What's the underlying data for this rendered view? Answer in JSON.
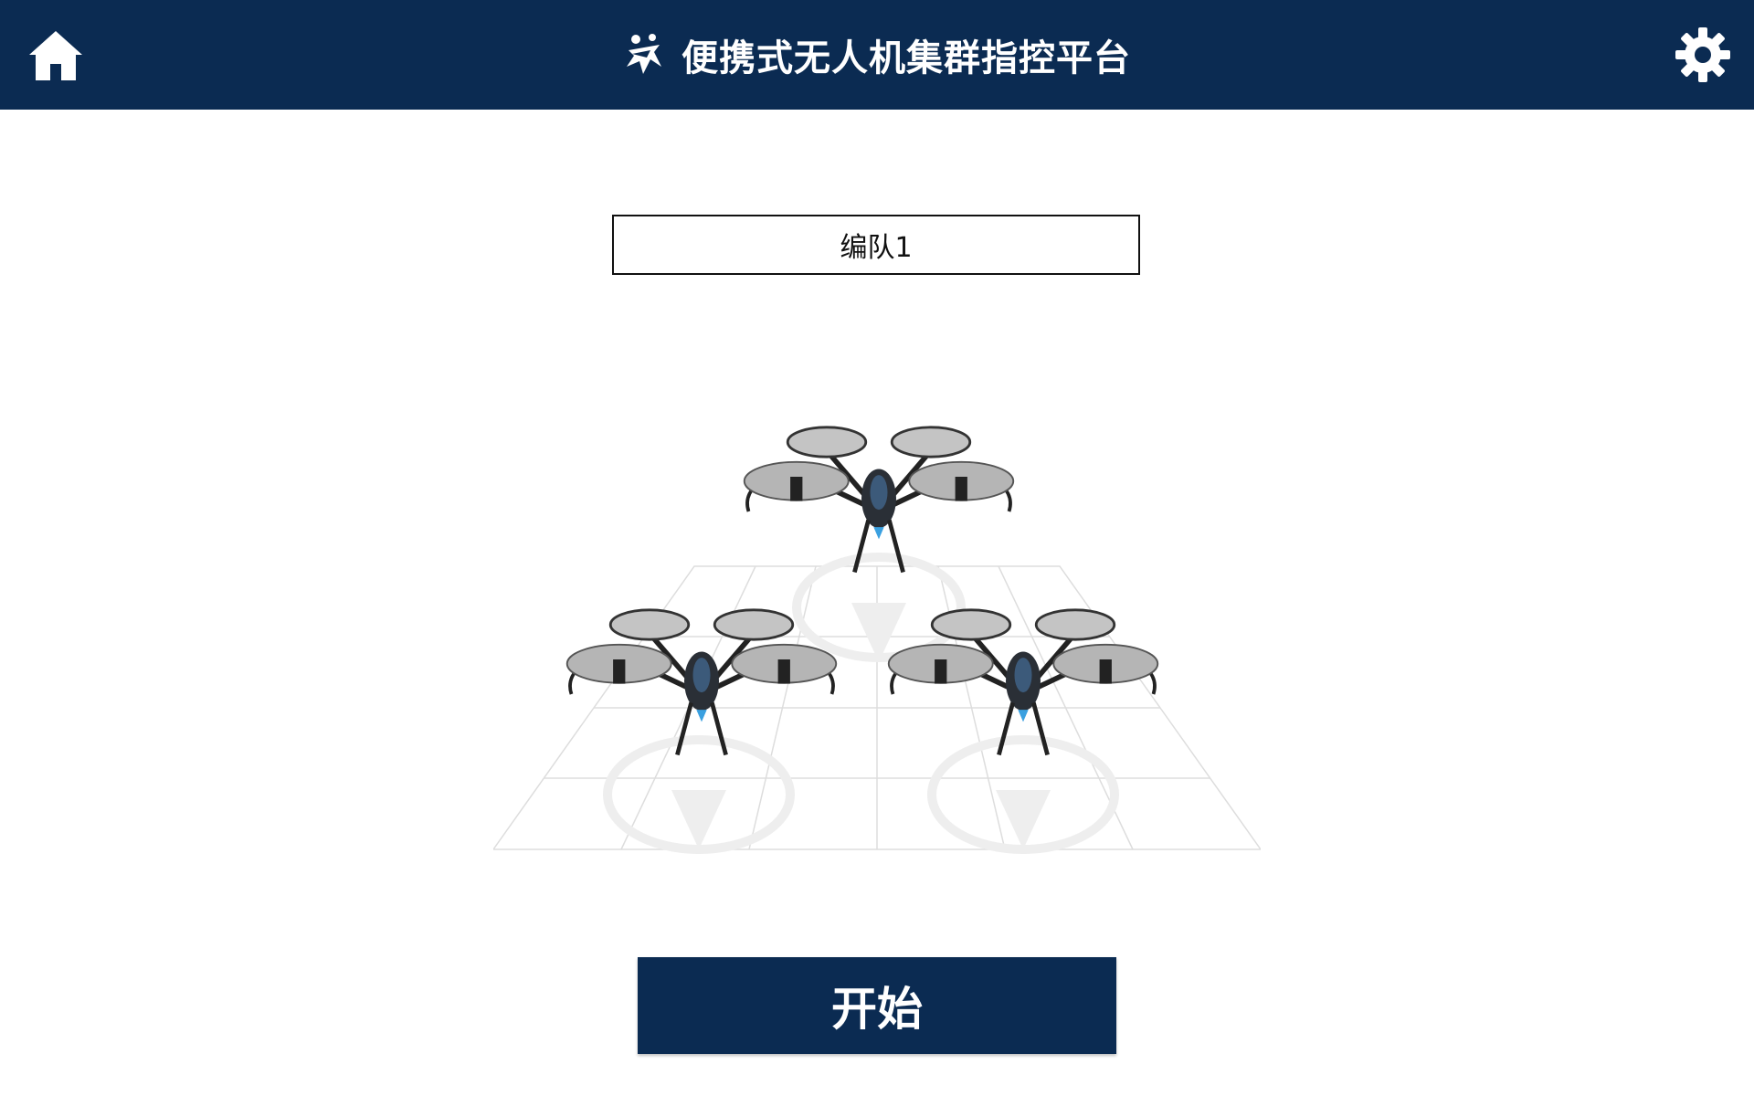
{
  "header": {
    "title": "便携式无人机集群指控平台",
    "home_icon": "home-icon",
    "settings_icon": "gear-icon",
    "logo_icon": "drone-logo-icon",
    "background_color": "#0b2b52"
  },
  "formation": {
    "name": "编队1"
  },
  "illustration": {
    "drone_count": 3,
    "icon": "drone-icon"
  },
  "actions": {
    "start_label": "开始",
    "button_color": "#0b2b52"
  }
}
